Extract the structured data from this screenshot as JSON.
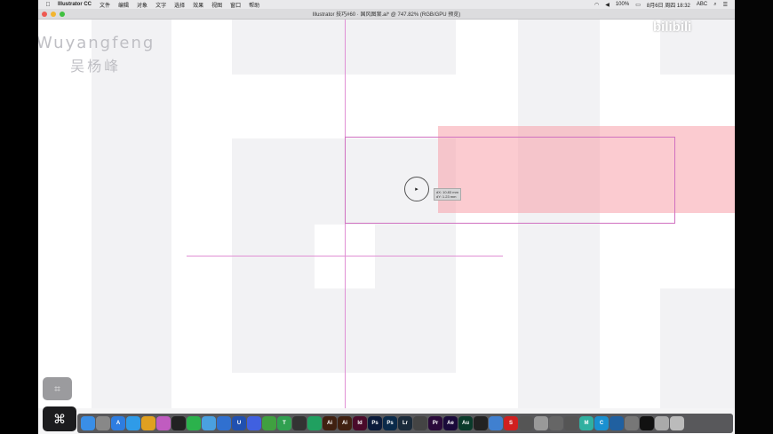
{
  "menubar": {
    "app_name": "Illustrator CC",
    "items": [
      "文件",
      "编辑",
      "对象",
      "文字",
      "选择",
      "效果",
      "视图",
      "窗口",
      "帮助"
    ],
    "battery": "100%",
    "datetime": "8月6日 周四  18:32",
    "input": "ABC"
  },
  "window": {
    "title": "Illustrator 技巧#60 · 国风图案.ai* @ 747.82% (RGB/GPU 预览)"
  },
  "watermark": {
    "name_en": "Wuyangfeng",
    "name_cn": "吴杨峰"
  },
  "tooltip": {
    "line1": "dX: 10.83 mm",
    "line2": "dY: 1.23 mm"
  },
  "bilibili": "bilibili",
  "cmd_symbol": "⌘",
  "colors": {
    "guide": "#e090d4",
    "pink_fill": "#f8a0aa",
    "selection": "#d070c0"
  },
  "dock": {
    "apps": [
      {
        "icon": "finder-icon",
        "label": "",
        "color": "#3a8ee6"
      },
      {
        "icon": "launchpad-icon",
        "label": "",
        "color": "#888"
      },
      {
        "icon": "appstore-icon",
        "label": "A",
        "color": "#2e7de0"
      },
      {
        "icon": "safari-icon",
        "label": "",
        "color": "#2f9be8"
      },
      {
        "icon": "chrome-icon",
        "label": "",
        "color": "#e0a020"
      },
      {
        "icon": "photos-icon",
        "label": "",
        "color": "#c05cc0"
      },
      {
        "icon": "qq-icon",
        "label": "",
        "color": "#222"
      },
      {
        "icon": "wechat-icon",
        "label": "",
        "color": "#2bb24c"
      },
      {
        "icon": "mail-icon",
        "label": "",
        "color": "#4aa0e0"
      },
      {
        "icon": "app-icon",
        "label": "",
        "color": "#3070d0"
      },
      {
        "icon": "u-icon",
        "label": "U",
        "color": "#2050b0"
      },
      {
        "icon": "baidu-icon",
        "label": "",
        "color": "#4060e0"
      },
      {
        "icon": "maps-icon",
        "label": "",
        "color": "#40a040"
      },
      {
        "icon": "t-icon",
        "label": "T",
        "color": "#30a050"
      },
      {
        "icon": "eye-icon",
        "label": "",
        "color": "#333"
      },
      {
        "icon": "green-icon",
        "label": "",
        "color": "#20a060"
      },
      {
        "icon": "ai-icon",
        "label": "Ai",
        "color": "#402010"
      },
      {
        "icon": "ai-icon-2",
        "label": "Ai",
        "color": "#402010"
      },
      {
        "icon": "indesign-icon",
        "label": "Id",
        "color": "#4a0a2a"
      },
      {
        "icon": "photoshop-icon",
        "label": "Ps",
        "color": "#0a1a3a"
      },
      {
        "icon": "photoshop-icon-2",
        "label": "Ps",
        "color": "#0a2a4a"
      },
      {
        "icon": "lightroom-icon",
        "label": "Lr",
        "color": "#1a2a3a"
      },
      {
        "icon": "clapper-icon",
        "label": "",
        "color": "#444"
      },
      {
        "icon": "premiere-icon",
        "label": "Pr",
        "color": "#2a0a3a"
      },
      {
        "icon": "aftereffects-icon",
        "label": "Ae",
        "color": "#1a0a3a"
      },
      {
        "icon": "audition-icon",
        "label": "Au",
        "color": "#0a3a2a"
      },
      {
        "icon": "record-icon",
        "label": "",
        "color": "#222"
      },
      {
        "icon": "gear-icon",
        "label": "",
        "color": "#4080d0"
      },
      {
        "icon": "s-icon",
        "label": "S",
        "color": "#d02020"
      },
      {
        "icon": "bird-icon",
        "label": "",
        "color": "#555"
      },
      {
        "icon": "scissors-icon",
        "label": "",
        "color": "#999"
      },
      {
        "icon": "star-icon",
        "label": "",
        "color": "#666"
      },
      {
        "icon": "mosaic-icon",
        "label": "",
        "color": "#555"
      },
      {
        "icon": "m-icon",
        "label": "M",
        "color": "#30b0a0"
      },
      {
        "icon": "c-icon",
        "label": "C",
        "color": "#1a90d0"
      },
      {
        "icon": "browser-icon",
        "label": "",
        "color": "#2060a0"
      },
      {
        "icon": "download-icon",
        "label": "",
        "color": "#777"
      },
      {
        "icon": "terminal-icon",
        "label": "",
        "color": "#111"
      },
      {
        "icon": "preview-icon",
        "label": "",
        "color": "#aaa"
      },
      {
        "icon": "trash-icon",
        "label": "",
        "color": "#bbb"
      }
    ]
  }
}
